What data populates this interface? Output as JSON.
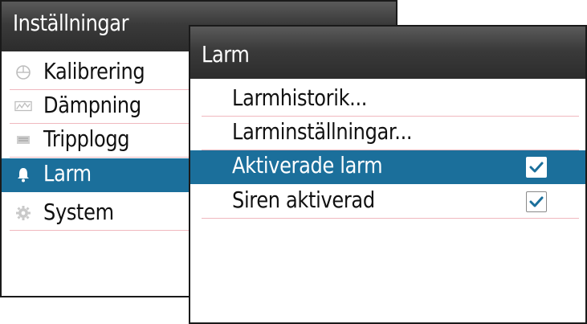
{
  "settings_menu": {
    "title": "Inställningar",
    "items": [
      {
        "label": "Kalibrering",
        "icon": "calibration-icon"
      },
      {
        "label": "Dämpning",
        "icon": "damping-icon"
      },
      {
        "label": "Tripplogg",
        "icon": "triplog-icon"
      },
      {
        "label": "Larm",
        "icon": "bell-icon",
        "selected": true
      },
      {
        "label": "System",
        "icon": "gear-icon"
      }
    ]
  },
  "alarm_menu": {
    "title": "Larm",
    "items": [
      {
        "label": "Larmhistorik..."
      },
      {
        "label": "Larminställningar..."
      },
      {
        "label": "Aktiverade larm",
        "checked": true,
        "selected": true
      },
      {
        "label": "Siren aktiverad",
        "checked": true
      }
    ]
  },
  "colors": {
    "header": "#3a3a3a",
    "selection": "#1b6f9b",
    "divider": "#f0b8bf",
    "check": "#1b6f9b"
  }
}
